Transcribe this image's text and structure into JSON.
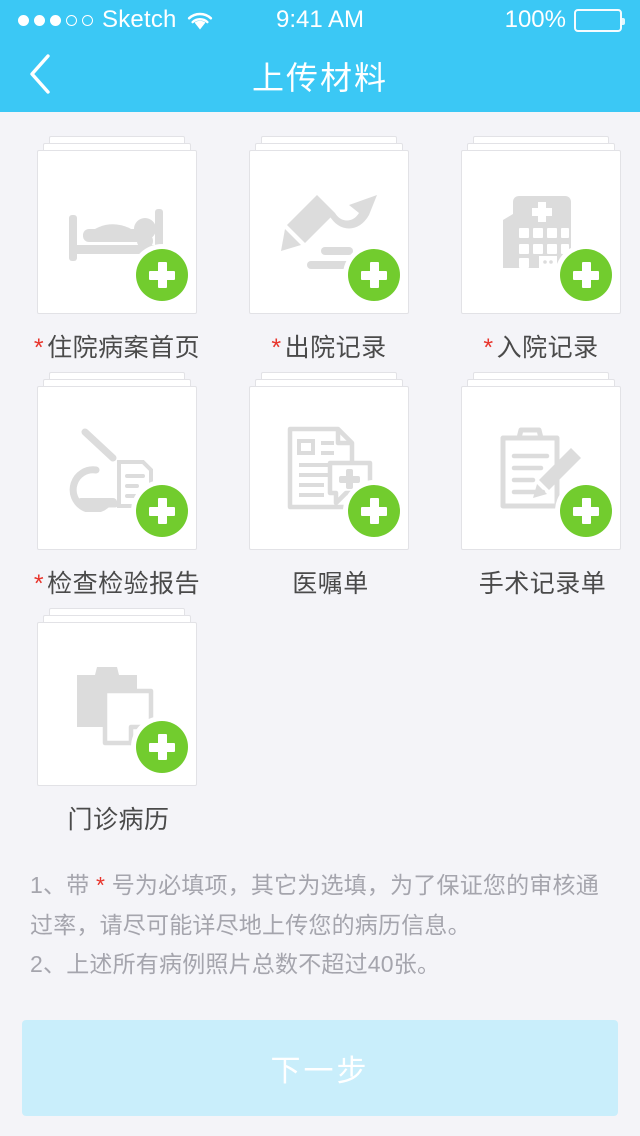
{
  "status_bar": {
    "carrier": "Sketch",
    "time": "9:41 AM",
    "battery_percent": "100%",
    "signal_dots_filled": 3,
    "signal_dots_total": 5,
    "wifi_icon": "wifi-icon",
    "battery_icon": "battery-icon"
  },
  "nav": {
    "title": "上传材料",
    "back_icon": "chevron-left-icon",
    "background_color": "#3bc8f5"
  },
  "theme": {
    "header_blue": "#3bc8f5",
    "page_background": "#f4f4f8",
    "badge_green": "#72cc2e",
    "required_red": "#e8352c",
    "label_gray": "#4a4a4a",
    "note_gray": "#a5a5ad",
    "button_disabled": "#c9eefb"
  },
  "upload_items": [
    {
      "label": "住院病案首页",
      "required": true,
      "star": "*",
      "icon": "hospital-bed-icon",
      "add_icon": "plus-circle-icon"
    },
    {
      "label": "出院记录",
      "required": true,
      "star": "*",
      "icon": "pencil-arrow-icon",
      "add_icon": "plus-circle-icon"
    },
    {
      "label": "入院记录",
      "required": true,
      "star": "*",
      "icon": "hospital-building-icon",
      "add_icon": "plus-circle-icon"
    },
    {
      "label": "检查检验报告",
      "required": true,
      "star": "*",
      "icon": "microscope-report-icon",
      "add_icon": "plus-circle-icon"
    },
    {
      "label": "医嘱单",
      "required": false,
      "star": "",
      "icon": "prescription-doc-icon",
      "add_icon": "plus-circle-icon"
    },
    {
      "label": "手术记录单",
      "required": false,
      "star": "",
      "icon": "clipboard-pen-icon",
      "add_icon": "plus-circle-icon"
    },
    {
      "label": "门诊病历",
      "required": false,
      "star": "",
      "icon": "clipboard-page-icon",
      "add_icon": "plus-circle-icon"
    }
  ],
  "notes": {
    "line1_prefix": "1、带 ",
    "line1_star": "*",
    "line1_suffix": " 号为必填项，其它为选填，为了保证您的审核通过率，请尽可能详尽地上传您的病历信息。",
    "line2": "2、上述所有病例照片总数不超过40张。"
  },
  "footer": {
    "next_label": "下一步"
  }
}
